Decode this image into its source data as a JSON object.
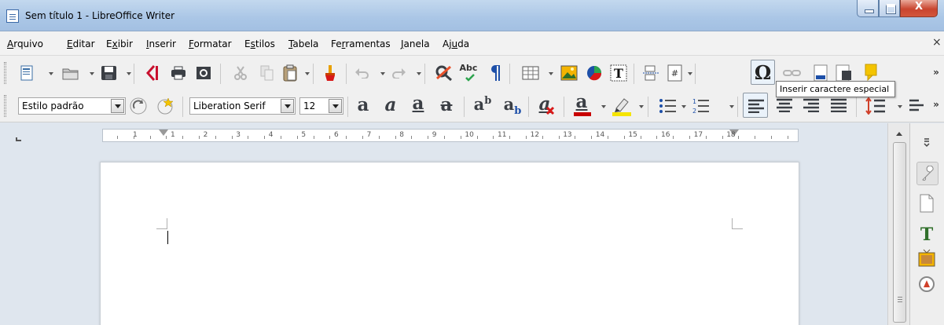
{
  "window": {
    "title": "Sem título 1 - LibreOffice Writer",
    "close_glyph": "X"
  },
  "menu": [
    {
      "label": "Arquivo"
    },
    {
      "label": "Editar"
    },
    {
      "label": "Exibir"
    },
    {
      "label": "Inserir"
    },
    {
      "label": "Formatar"
    },
    {
      "label": "Estilos"
    },
    {
      "label": "Tabela"
    },
    {
      "label": "Ferramentas"
    },
    {
      "label": "Janela"
    },
    {
      "label": "Ajuda"
    }
  ],
  "menu_close": "×",
  "toolbar1": {
    "spellcheck_label": "Abc",
    "overflow": "»"
  },
  "tooltip": "Inserir caractere especial",
  "formatting": {
    "paragraph_style": "Estilo padrão",
    "font_name": "Liberation Serif",
    "font_size": "12",
    "overflow": "»"
  },
  "ruler": {
    "numbers": [
      "1",
      "1",
      "2",
      "3",
      "4",
      "5",
      "6",
      "7",
      "8",
      "9",
      "10",
      "11",
      "12",
      "13",
      "14",
      "15",
      "16",
      "17",
      "18"
    ]
  },
  "colors": {
    "font_color": "#c80000",
    "highlight_color": "#f5e400"
  }
}
